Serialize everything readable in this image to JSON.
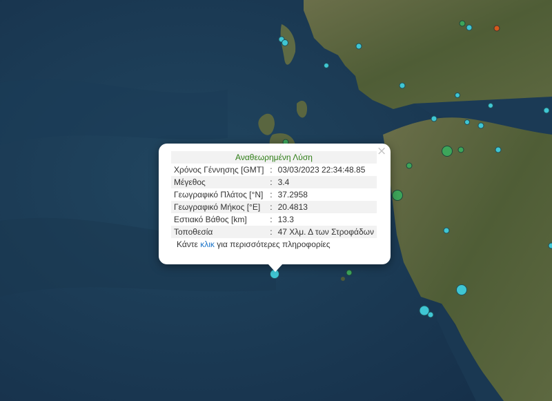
{
  "popup": {
    "title": "Αναθεωρημένη Λύση",
    "rows": [
      {
        "label": "Χρόνος Γέννησης [GMT]",
        "sep": ":",
        "value": "03/03/2023 22:34:48.85"
      },
      {
        "label": "Μέγεθος",
        "sep": ":",
        "value": "3.4"
      },
      {
        "label": "Γεωγραφικό Πλάτος [°N]",
        "sep": ":",
        "value": "37.2958"
      },
      {
        "label": "Γεωγραφικό Μήκος [°E]",
        "sep": ":",
        "value": "20.4813"
      },
      {
        "label": "Εστιακό Βάθος [km]",
        "sep": ":",
        "value": "13.3"
      },
      {
        "label": "Τοποθεσία",
        "sep": ":",
        "value": "47 Χλμ. Δ των Στροφάδων"
      }
    ],
    "more_prefix": "Κάντε ",
    "more_link": "κλικ",
    "more_suffix": " για περισσότερες πληροφορίες",
    "close_label": "×"
  },
  "colors": {
    "sea": "#1d3a52",
    "land": "#55613e",
    "popup_title": "#2e7d16",
    "link": "#1a73c8",
    "marker_cyan": "#3fc6d3",
    "marker_green": "#3da55a",
    "marker_orange": "#d4591c"
  }
}
